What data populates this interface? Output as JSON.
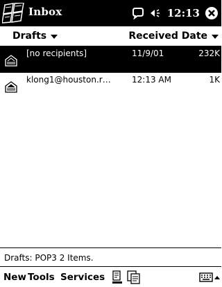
{
  "titlebar": {
    "title": "Inbox",
    "clock": "12:13",
    "icons": {
      "start": "windows-flag-icon",
      "connectivity": "connectivity-icon",
      "volume": "speaker-icon",
      "close": "close-icon"
    }
  },
  "header": {
    "folder": "Drafts",
    "sort": "Received Date"
  },
  "messages": [
    {
      "sender": "[no recipients]",
      "date": "11/9/01",
      "size": "232K",
      "selected": true,
      "icon": "draft-envelope-icon"
    },
    {
      "sender": "klong1@houston.r…",
      "date": "12:13 AM",
      "size": "1K",
      "selected": false,
      "icon": "draft-envelope-icon"
    }
  ],
  "status": "Drafts: POP3  2 Items.",
  "commandbar": {
    "menus": [
      "New",
      "Tools",
      "Services"
    ],
    "icons": [
      "send-receive-icon",
      "folder-list-icon",
      "keyboard-icon",
      "sip-up-arrow-icon"
    ]
  },
  "colors": {
    "titlebar_bg": "#000000",
    "selection_bg": "#000000",
    "text": "#000000",
    "background": "#ffffff"
  }
}
